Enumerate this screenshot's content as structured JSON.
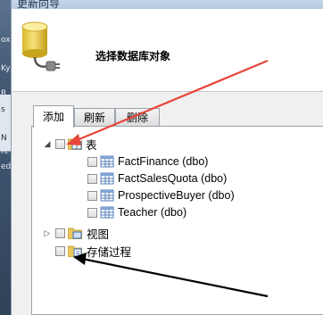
{
  "window": {
    "title": "更新向导"
  },
  "background_glyphs": [
    "ox",
    "Ky",
    "R",
    "s",
    "N",
    "re",
    "ed"
  ],
  "header": {
    "title": "选择数据库对象",
    "icon": "database-plug-icon"
  },
  "tabs": [
    {
      "label": "添加",
      "active": true
    },
    {
      "label": "刷新",
      "active": false
    },
    {
      "label": "删除",
      "active": false
    }
  ],
  "tree": {
    "tables": {
      "label": "表",
      "expanded": true,
      "items": [
        {
          "label": "FactFinance (dbo)"
        },
        {
          "label": "FactSalesQuota (dbo)"
        },
        {
          "label": "ProspectiveBuyer (dbo)"
        },
        {
          "label": "Teacher (dbo)"
        }
      ]
    },
    "views": {
      "label": "视图",
      "expanded": false
    },
    "procedures": {
      "label": "存储过程"
    }
  },
  "annotations": {
    "arrow_top_color": "#e8463a",
    "arrow_bottom_color": "#000000"
  }
}
